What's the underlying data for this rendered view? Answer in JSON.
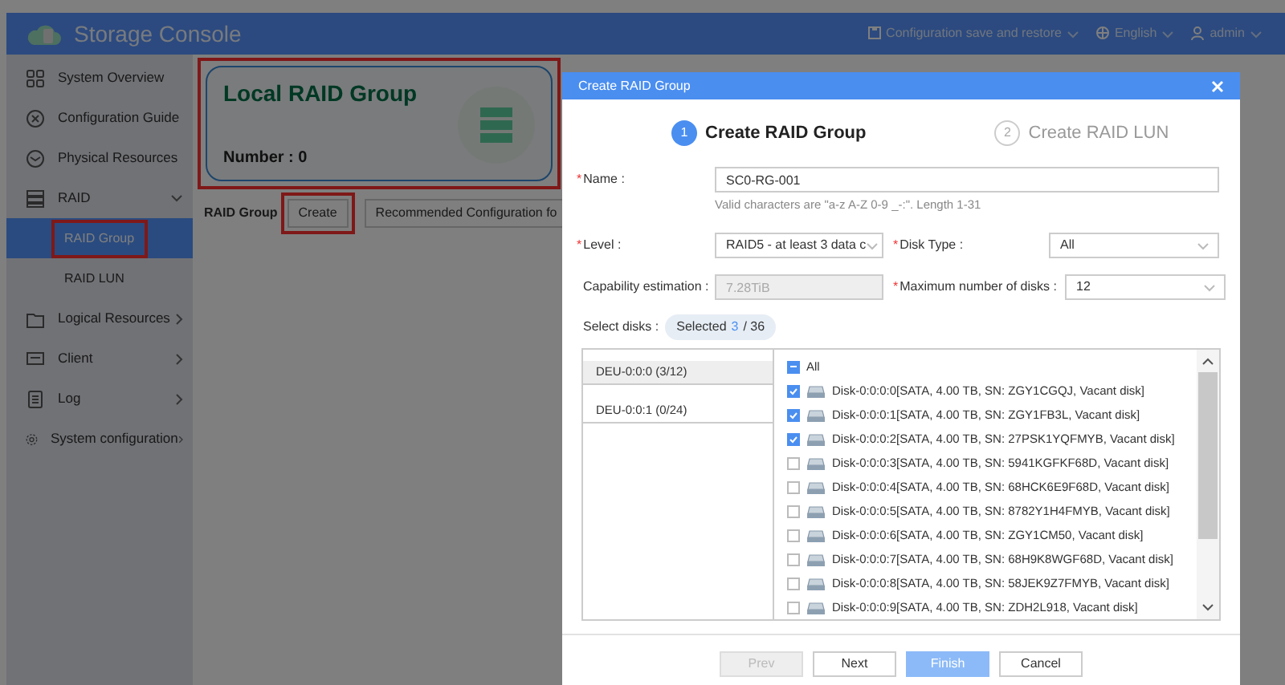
{
  "app": {
    "title": "Storage Console"
  },
  "top_menu": [
    {
      "label": "Configuration save and restore"
    },
    {
      "label": "English"
    },
    {
      "label": "admin"
    }
  ],
  "sidebar": {
    "items": [
      {
        "label": "System Overview",
        "kind": "link"
      },
      {
        "label": "Configuration Guide",
        "kind": "link"
      },
      {
        "label": "Physical Resources",
        "kind": "link"
      },
      {
        "label": "RAID",
        "kind": "group",
        "expanded": true,
        "children": [
          {
            "label": "RAID Group",
            "selected": true,
            "highlighted": true
          },
          {
            "label": "RAID LUN",
            "selected": false,
            "highlighted": false
          }
        ]
      },
      {
        "label": "Logical Resources",
        "kind": "group",
        "expanded": false
      },
      {
        "label": "Client",
        "kind": "group",
        "expanded": false
      },
      {
        "label": "Log",
        "kind": "group",
        "expanded": false
      },
      {
        "label": "System configuration",
        "kind": "group",
        "expanded": false
      }
    ]
  },
  "card": {
    "title": "Local RAID Group",
    "count": "Number : 0",
    "highlighted": true
  },
  "toolbar": {
    "label": "RAID Group",
    "buttons": [
      {
        "label": "Create",
        "highlighted": true
      },
      {
        "label": "Recommended Configuration fo",
        "highlighted": false
      }
    ]
  },
  "dialog": {
    "title": "Create RAID Group",
    "steps": [
      {
        "number": "1",
        "label": "Create RAID Group",
        "selected": true
      },
      {
        "number": "2",
        "label": "Create RAID LUN",
        "selected": false
      }
    ],
    "name": {
      "label": "Name :",
      "required_mark": "*",
      "value": "SC0-RG-001",
      "hint": "Valid characters are \"a-z A-Z 0-9 _-:\". Length 1-31"
    },
    "level": {
      "label": "Level :",
      "required_mark": "*",
      "value": "RAID5 - at least 3 data c"
    },
    "disk_type": {
      "label": "Disk Type :",
      "required_mark": "*",
      "value": "All"
    },
    "capability": {
      "label": "Capability estimation :",
      "value": "7.28TiB",
      "disabled": true
    },
    "max_disks": {
      "label": "Maximum number of disks :",
      "required_mark": "*",
      "value": "12"
    },
    "select_disks": {
      "label": "Select disks :",
      "prefix": "Selected",
      "count": "3",
      "total": "/ 36"
    },
    "enclosures": [
      {
        "label": "DEU-0:0:0 (3/12)",
        "selected": true
      },
      {
        "label": "DEU-0:0:1 (0/24)",
        "selected": false
      }
    ],
    "all": {
      "label": "All",
      "indeterminate": true
    },
    "disks": [
      {
        "label": "Disk-0:0:0:0[SATA, 4.00 TB, SN: ZGY1CGQJ, Vacant disk]",
        "checked": true
      },
      {
        "label": "Disk-0:0:0:1[SATA, 4.00 TB, SN: ZGY1FB3L, Vacant disk]",
        "checked": true
      },
      {
        "label": "Disk-0:0:0:2[SATA, 4.00 TB, SN: 27PSK1YQFMYB, Vacant disk]",
        "checked": true
      },
      {
        "label": "Disk-0:0:0:3[SATA, 4.00 TB, SN: 5941KGFKF68D, Vacant disk]",
        "checked": false
      },
      {
        "label": "Disk-0:0:0:4[SATA, 4.00 TB, SN: 68HCK6E9F68D, Vacant disk]",
        "checked": false
      },
      {
        "label": "Disk-0:0:0:5[SATA, 4.00 TB, SN: 8782Y1H4FMYB, Vacant disk]",
        "checked": false
      },
      {
        "label": "Disk-0:0:0:6[SATA, 4.00 TB, SN: ZGY1CM50, Vacant disk]",
        "checked": false
      },
      {
        "label": "Disk-0:0:0:7[SATA, 4.00 TB, SN: 68H9K8WGF68D, Vacant disk]",
        "checked": false
      },
      {
        "label": "Disk-0:0:0:8[SATA, 4.00 TB, SN: 58JEK9Z7FMYB, Vacant disk]",
        "checked": false
      },
      {
        "label": "Disk-0:0:0:9[SATA, 4.00 TB, SN: ZDH2L918, Vacant disk]",
        "checked": false
      }
    ],
    "buttons": [
      {
        "label": "Prev",
        "kind": "default",
        "disabled": true
      },
      {
        "label": "Next",
        "kind": "default",
        "disabled": false
      },
      {
        "label": "Finish",
        "kind": "primary",
        "disabled": true
      },
      {
        "label": "Cancel",
        "kind": "default",
        "disabled": false
      }
    ]
  }
}
